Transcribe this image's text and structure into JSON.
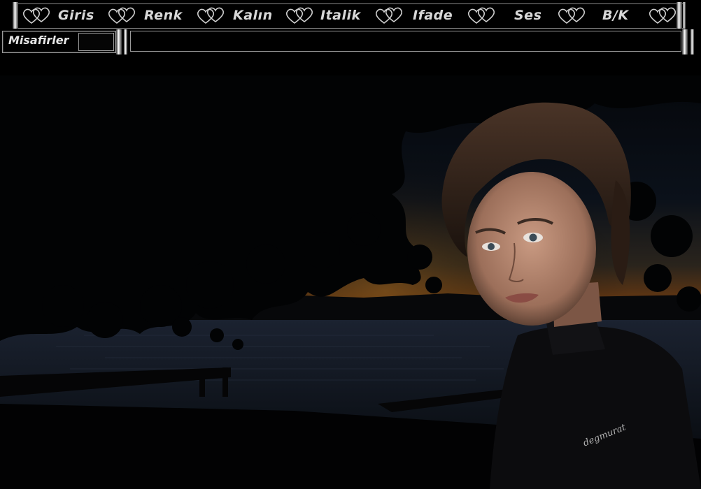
{
  "toolbar": {
    "items": [
      {
        "label": "Giris",
        "icon": "hearts-icon"
      },
      {
        "label": "Renk",
        "icon": "hearts-icon"
      },
      {
        "label": "Kalın",
        "icon": "hearts-icon"
      },
      {
        "label": "Italik",
        "icon": "hearts-icon"
      },
      {
        "label": "Ifade",
        "icon": "hearts-icon"
      },
      {
        "label": "Ses",
        "icon": "hearts-icon"
      },
      {
        "label": "B/K",
        "icon": "hearts-icon"
      }
    ]
  },
  "guests": {
    "label": "Misafirler",
    "count": ""
  },
  "chat": {
    "value": ""
  },
  "scene": {
    "watermark": "degmurat"
  },
  "colors": {
    "background": "#000000",
    "text": "#d8d8d8",
    "border": "#9a9a9a"
  }
}
